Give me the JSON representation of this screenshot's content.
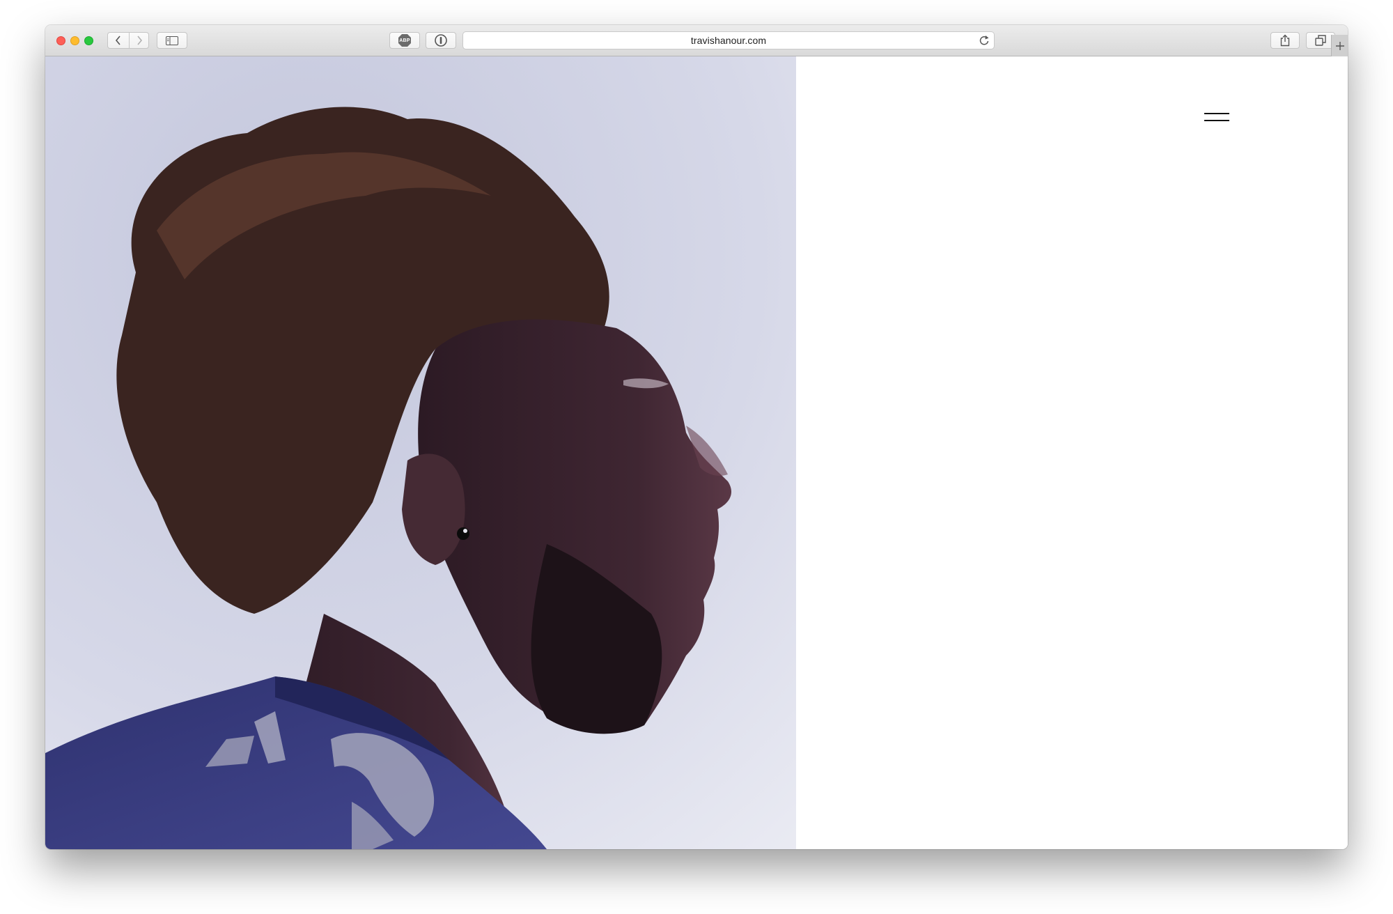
{
  "browser": {
    "url": "travishanour.com",
    "toolbar_icons": [
      "back-icon",
      "forward-icon",
      "sidebar-icon",
      "adblock-icon",
      "onepassword-icon",
      "reload-icon",
      "share-icon",
      "tabs-icon",
      "new-tab-icon"
    ],
    "adblock_label": "ABP"
  },
  "page": {
    "hero_image": "profile-portrait-photo",
    "menu_icon": "hamburger-menu-icon"
  },
  "colors": {
    "photo_background": "#d4d7e8",
    "jersey": "#3a3d7a",
    "page_background": "#ffffff",
    "menu_bars": "#111111"
  }
}
